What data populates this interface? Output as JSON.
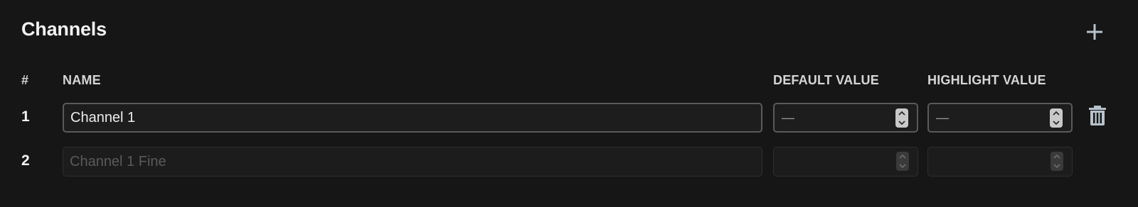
{
  "section": {
    "title": "Channels",
    "add_icon": "plus-icon"
  },
  "columns": {
    "index": "#",
    "name": "NAME",
    "default_value": "DEFAULT VALUE",
    "highlight_value": "HIGHLIGHT VALUE"
  },
  "rows": [
    {
      "index": "1",
      "name_value": "Channel 1",
      "default_value": "—",
      "highlight_value": "—",
      "editable": true,
      "delete_icon": "trash-icon"
    },
    {
      "index": "2",
      "name_placeholder": "Channel 1 Fine",
      "default_value": "",
      "highlight_value": "",
      "editable": false
    }
  ],
  "colors": {
    "background": "#161616",
    "field_border": "#5a5a5a",
    "icon": "#b8c3cc"
  }
}
